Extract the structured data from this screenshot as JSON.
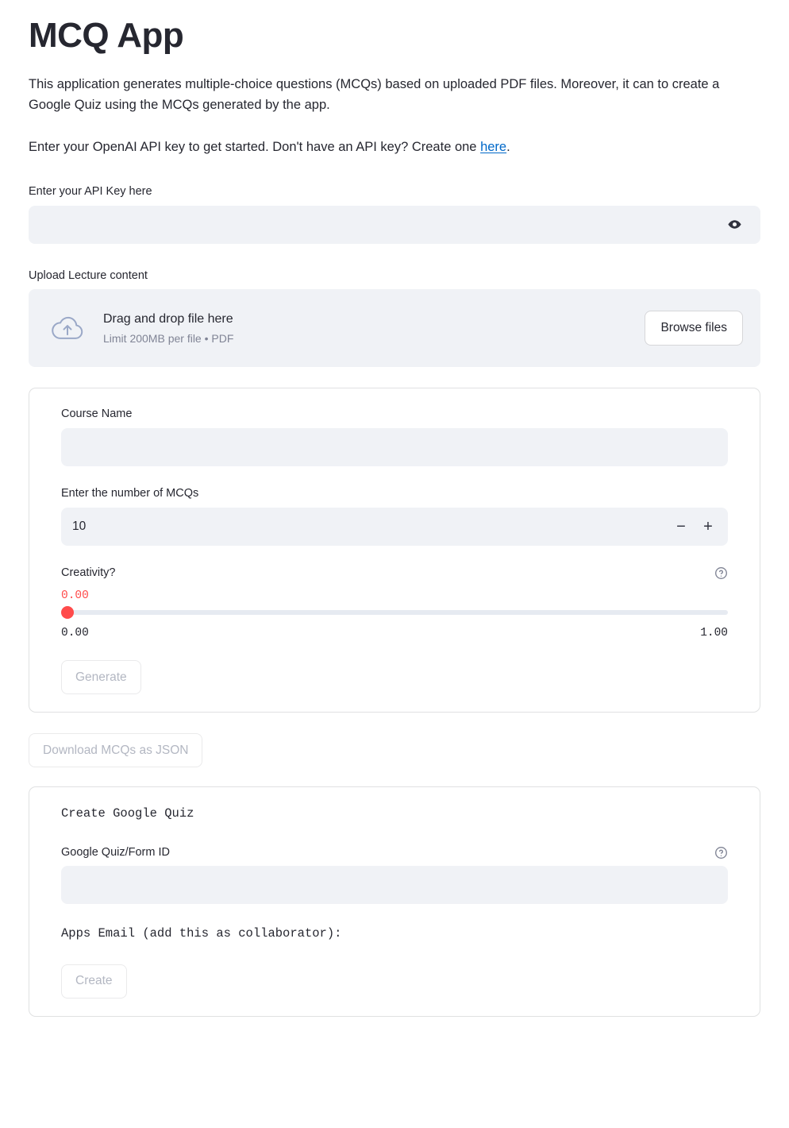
{
  "app": {
    "title": "MCQ App",
    "description_1": "This application generates multiple-choice questions (MCQs) based on uploaded PDF files. Moreover, it can to create a Google Quiz using the MCQs generated by the app.",
    "description_2_before": "Enter your OpenAI API key to get started. Don't have an API key? Create one ",
    "description_2_link": "here",
    "description_2_after": "."
  },
  "api_key": {
    "label": "Enter your API Key here",
    "value": "",
    "placeholder": "",
    "toggle_icon": "eye-icon"
  },
  "uploader": {
    "label": "Upload Lecture content",
    "drag_text": "Drag and drop file here",
    "limit_text": "Limit 200MB per file • PDF",
    "browse_label": "Browse files",
    "icon": "cloud-upload-icon"
  },
  "form": {
    "course_name": {
      "label": "Course Name",
      "value": "",
      "placeholder": ""
    },
    "num_mcqs": {
      "label": "Enter the number of MCQs",
      "value": "10",
      "decrement_label": "−",
      "increment_label": "+"
    },
    "creativity": {
      "label": "Creativity?",
      "help_icon": "circle-question-icon",
      "current_value": "0.00",
      "min_label": "0.00",
      "max_label": "1.00",
      "fill_percent": 0,
      "accent_color": "#ff4b4b"
    },
    "generate_button": {
      "label": "Generate",
      "disabled": true
    }
  },
  "download_button": {
    "label": "Download MCQs as JSON",
    "disabled": true
  },
  "quiz": {
    "heading": "Create Google Quiz",
    "form_id": {
      "label": "Google Quiz/Form ID",
      "value": "",
      "placeholder": "",
      "help_icon": "circle-question-icon"
    },
    "apps_email_label": "Apps Email (add this as collaborator): ",
    "apps_email_value": "",
    "create_button": {
      "label": "Create",
      "disabled": true
    }
  },
  "colors": {
    "accent": "#ff4b4b",
    "link": "#0068c9",
    "text": "#262730",
    "muted": "#808495",
    "input_bg": "#f0f2f6",
    "border": "rgba(49,51,63,0.15)"
  }
}
